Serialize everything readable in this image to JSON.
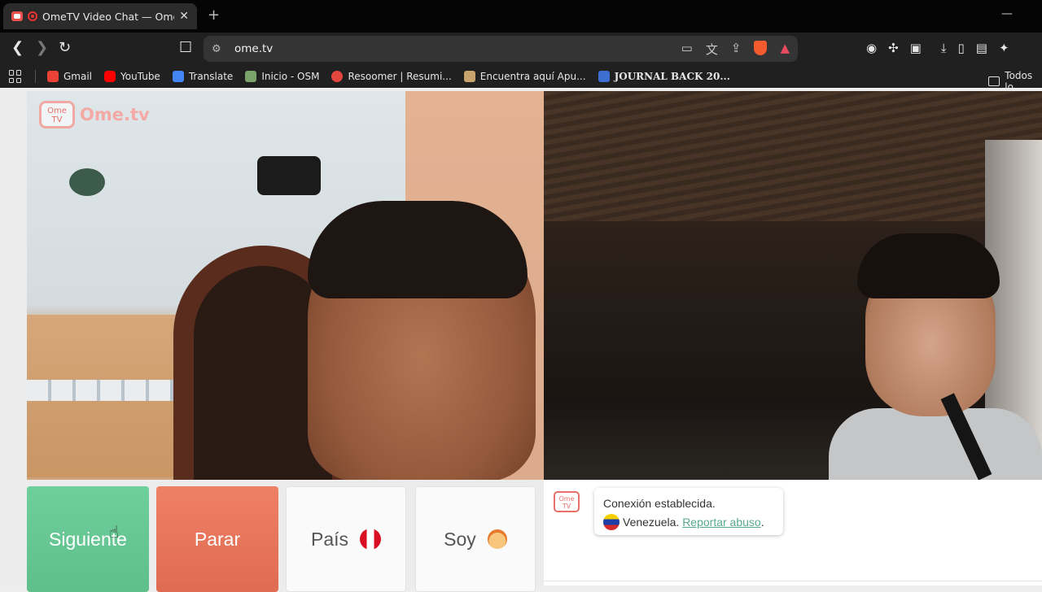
{
  "browser": {
    "tab_title": "OmeTV Video Chat — Omegl",
    "tab_close": "✕",
    "new_tab": "+",
    "minimize": "—",
    "url": "ome.tv"
  },
  "bookmarks": {
    "items": [
      {
        "label": "Gmail",
        "icon_color": "#ea4335"
      },
      {
        "label": "YouTube",
        "icon_color": "#ff0000"
      },
      {
        "label": "Translate",
        "icon_color": "#4285f4"
      },
      {
        "label": "Inicio - OSM",
        "icon_color": "#7aa36b"
      },
      {
        "label": "Resoomer | Resumi...",
        "icon_color": "#e2463f"
      },
      {
        "label": "Encuentra aquí Apu...",
        "icon_color": "#c8a36b"
      },
      {
        "label": "JOURNAL BACK 20...",
        "icon_color": "#3d6fd1"
      }
    ],
    "all_label": "Todos lo"
  },
  "video": {
    "logo_badge": "Ome TV",
    "logo_text": "Ome.tv"
  },
  "controls": {
    "next_label": "Siguiente",
    "stop_label": "Parar",
    "country_label": "País",
    "gender_label": "Soy"
  },
  "chat": {
    "avatar_text": "Ome TV",
    "status": "Conexión establecida.",
    "country": "Venezuela.",
    "report_link": "Reportar abuso",
    "report_suffix": "."
  },
  "colors": {
    "next_button": "#66c794",
    "stop_button": "#e8755b",
    "accent_link": "#58a98e"
  }
}
